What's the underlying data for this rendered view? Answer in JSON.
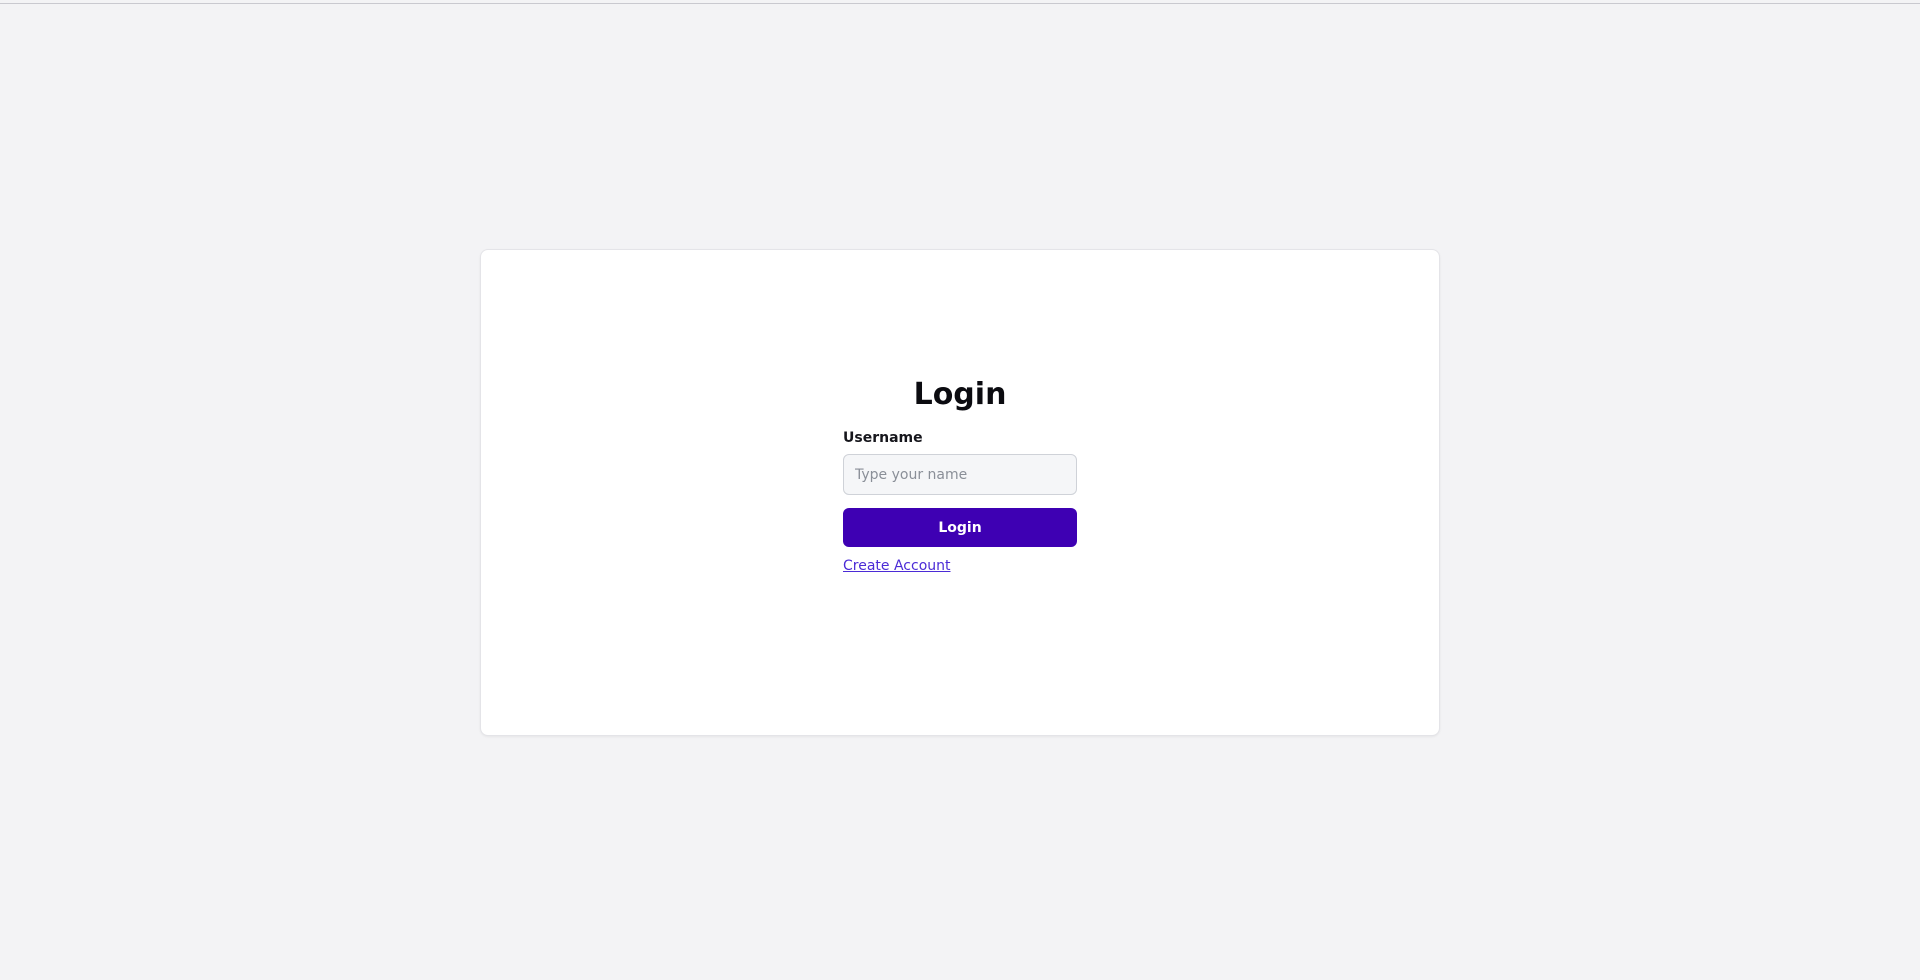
{
  "login": {
    "title": "Login",
    "username_label": "Username",
    "username_value": "",
    "username_placeholder": "Type your name",
    "login_button_label": "Login",
    "create_account_link": "Create Account"
  },
  "colors": {
    "background": "#f3f3f5",
    "card": "#ffffff",
    "primary": "#3e00b3",
    "link": "#4b2bd6"
  }
}
